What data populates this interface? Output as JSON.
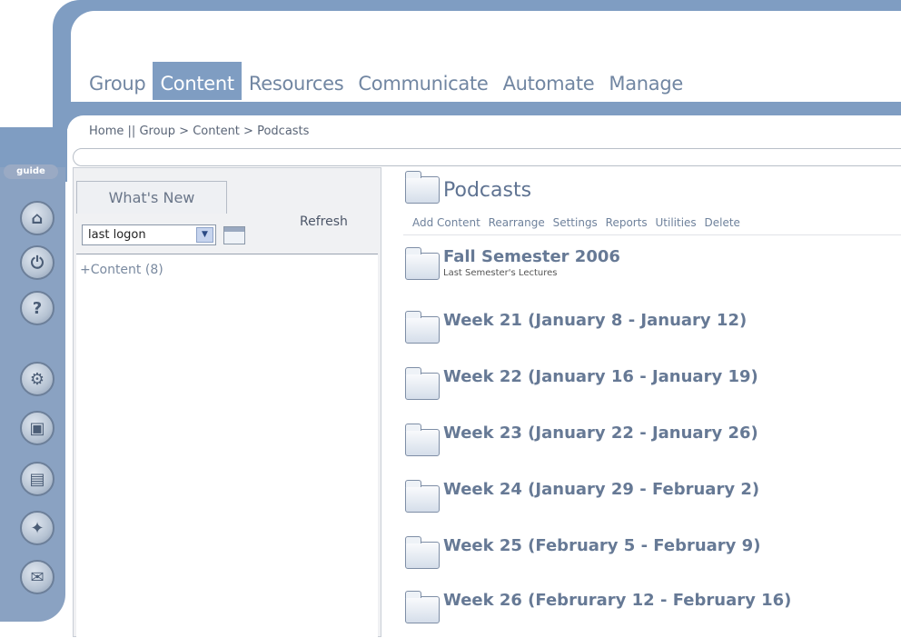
{
  "nav": {
    "tabs": [
      {
        "label": "Group"
      },
      {
        "label": "Content"
      },
      {
        "label": "Resources"
      },
      {
        "label": "Communicate"
      },
      {
        "label": "Automate"
      },
      {
        "label": "Manage"
      }
    ],
    "active_tab": "Content"
  },
  "breadcrumb": {
    "home": "Home",
    "sep1": "||",
    "group": "Group",
    "sep2": ">",
    "content": "Content",
    "sep3": ">",
    "current": "Podcasts"
  },
  "sidebar": {
    "guide_label": "guide",
    "icons": [
      "home-icon",
      "power-icon",
      "help-icon",
      "settings-icon",
      "camera-icon",
      "folder-icon",
      "wrench-icon",
      "chat-icon"
    ]
  },
  "whats_new": {
    "tab_label": "What's New",
    "filter_value": "last logon",
    "refresh_label": "Refresh",
    "item_label": "+Content (8)"
  },
  "main": {
    "title": "Podcasts",
    "actions": [
      "Add Content",
      "Rearrange",
      "Settings",
      "Reports",
      "Utilities",
      "Delete"
    ],
    "folders": [
      {
        "title": "Fall Semester 2006",
        "subtitle": "Last Semester's Lectures"
      },
      {
        "title": "Week 21 (January 8 - January 12)"
      },
      {
        "title": "Week 22 (January 16 - January 19)"
      },
      {
        "title": "Week 23 (January 22 - January 26)"
      },
      {
        "title": "Week 24 (January 29 - February 2)"
      },
      {
        "title": "Week 25 (February 5 - February 9)"
      },
      {
        "title": "Week 26 (Februrary 12 - February 16)"
      }
    ]
  },
  "colors": {
    "frame_blue": "#7f9dc2",
    "tab_text": "#7186a2",
    "folder_title": "#667995"
  }
}
